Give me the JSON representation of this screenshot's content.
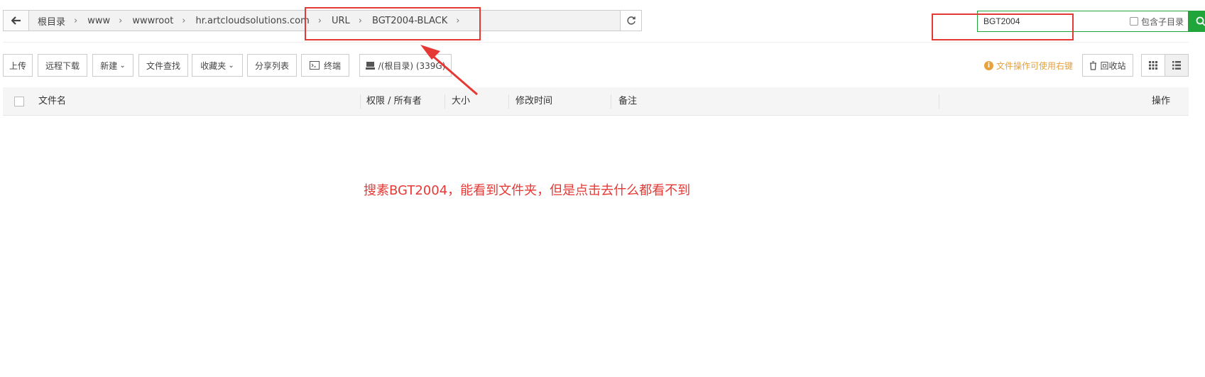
{
  "breadcrumb": {
    "items": [
      "根目录",
      "www",
      "wwwroot",
      "hr.artcloudsolutions.com",
      "URL",
      "BGT2004-BLACK"
    ],
    "separator": ">"
  },
  "search": {
    "value": "BGT2004",
    "include_subdir_label": "包含子目录"
  },
  "toolbar": {
    "upload": "上传",
    "remote_download": "远程下载",
    "new": "新建",
    "file_search": "文件查找",
    "favorites": "收藏夹",
    "share_list": "分享列表",
    "terminal": "终端",
    "disk": "/(根目录) (339G)",
    "tip": "文件操作可使用右键",
    "recycle_bin": "回收站"
  },
  "table": {
    "columns": [
      "文件名",
      "权限 / 所有者",
      "大小",
      "修改时间",
      "备注",
      "操作"
    ]
  },
  "annotation": {
    "text": "搜素BGT2004，能看到文件夹，但是点击去什么都看不到"
  },
  "colors": {
    "accent": "#20a53a",
    "annotation": "#e53935",
    "tip": "#e6a23c"
  },
  "icons": [
    "arrow-left-icon",
    "refresh-icon",
    "search-icon",
    "terminal-icon",
    "disk-icon",
    "info-icon",
    "trash-icon",
    "grid-view-icon",
    "list-view-icon"
  ]
}
